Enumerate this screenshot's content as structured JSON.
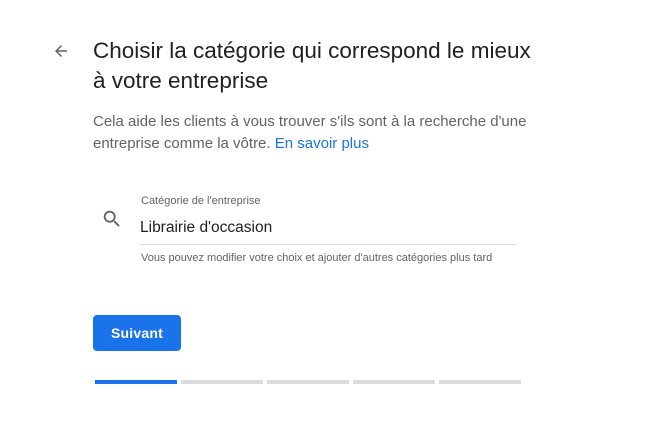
{
  "header": {
    "back_icon": "arrow-back-icon",
    "title": "Choisir la catégorie qui correspond le mieux à votre entreprise",
    "subtitle": "Cela aide les clients à vous trouver s'ils sont à la recherche d'une entreprise comme la vôtre.",
    "learn_more": "En savoir plus"
  },
  "category_field": {
    "icon": "search-icon",
    "label": "Catégorie de l'entreprise",
    "value": "Librairie d'occasion",
    "helper": "Vous pouvez modifier votre choix et ajouter d'autres catégories plus tard"
  },
  "actions": {
    "next_label": "Suivant"
  },
  "progress": {
    "total_steps": 5,
    "current_step": 1
  },
  "colors": {
    "accent": "#1a73e8",
    "text": "#202124",
    "muted": "#5f6368",
    "inactive_progress": "#dadce0"
  }
}
